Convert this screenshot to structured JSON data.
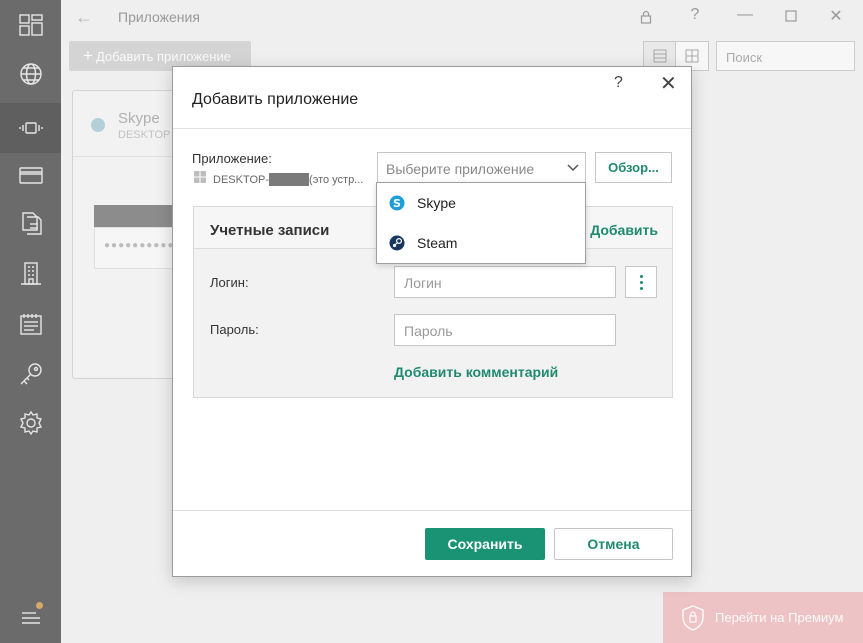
{
  "window": {
    "title": "Приложения",
    "add_app_label": "Добавить приложение",
    "search_placeholder": "Поиск",
    "help_glyph": "?"
  },
  "sidebar": {
    "items": [
      {
        "icon": "dashboard-icon"
      },
      {
        "icon": "globe-icon"
      },
      {
        "icon": "vibrate-device-icon"
      },
      {
        "icon": "credit-card-icon"
      },
      {
        "icon": "documents-icon"
      },
      {
        "icon": "building-icon"
      },
      {
        "icon": "notepad-icon"
      },
      {
        "icon": "key-icon"
      },
      {
        "icon": "settings-gear-icon"
      }
    ],
    "menu_icon": "menu-icon"
  },
  "app_card": {
    "title": "Skype",
    "subtitle": "DESKTOP",
    "password_mask": "●●●●●●●●●●"
  },
  "premium": {
    "label": "Перейти на Премиум"
  },
  "dialog": {
    "title": "Добавить приложение",
    "help_glyph": "?",
    "close_glyph": "✕",
    "app_label": "Приложение:",
    "device_prefix": "DESKTOP-",
    "device_suffix": "(это устр...",
    "select_placeholder": "Выберите приложение",
    "browse_label": "Обзор...",
    "accounts": {
      "title": "Учетные записи",
      "add_label": "Добавить",
      "login_label": "Логин:",
      "login_placeholder": "Логин",
      "password_label": "Пароль:",
      "password_placeholder": "Пароль",
      "add_comment_label": "Добавить комментарий"
    },
    "save_label": "Сохранить",
    "cancel_label": "Отмена"
  },
  "dropdown": {
    "options": [
      {
        "label": "Skype",
        "icon": "skype-icon"
      },
      {
        "label": "Steam",
        "icon": "steam-icon"
      }
    ]
  },
  "colors": {
    "accent": "#1a9374",
    "sidebar_bg": "#6b6b6b",
    "premium_bg": "#edc3c5"
  }
}
